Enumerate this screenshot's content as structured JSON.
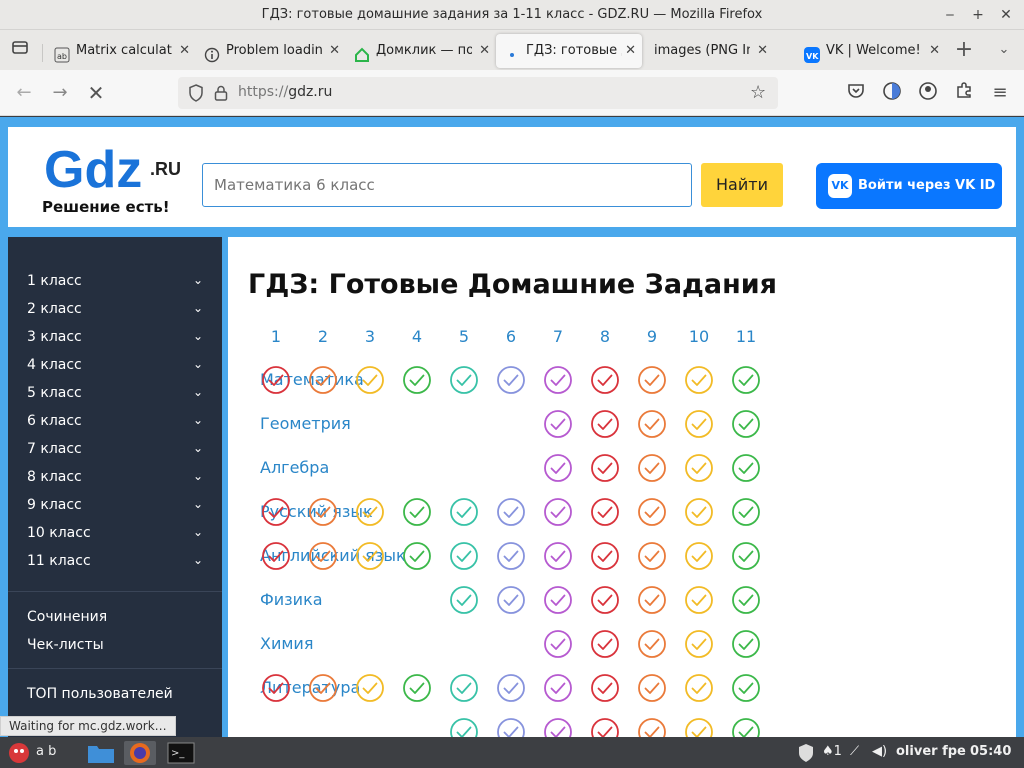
{
  "window": {
    "title": "ГДЗ: готовые домашние задания за 1-11 класс - GDZ.RU — Mozilla Firefox"
  },
  "tabs": [
    {
      "label": "Matrix calculator",
      "active": false
    },
    {
      "label": "Problem loading page",
      "active": false
    },
    {
      "label": "Домклик — по",
      "active": false
    },
    {
      "label": "ГДЗ: готовые д",
      "active": true
    },
    {
      "label": "images (PNG Image",
      "active": false
    },
    {
      "label": "VK | Welcome!",
      "active": false
    }
  ],
  "nav": {
    "url_scheme": "https://",
    "url_host": "gdz.ru"
  },
  "header": {
    "logo_main": "Gdz",
    "logo_tld": ".RU",
    "slogan": "Решение есть!",
    "search_placeholder": "Математика 6 класс",
    "search_button": "Найти",
    "vk_button": "Войти через  VK ID",
    "vk_icon": "VK"
  },
  "sidebar": {
    "grades": [
      "1 класс",
      "2 класс",
      "3 класс",
      "4 класс",
      "5 класс",
      "6 класс",
      "7 класс",
      "8 класс",
      "9 класс",
      "10 класс",
      "11 класс"
    ],
    "links": [
      "Сочинения",
      "Чек-листы"
    ],
    "top_users": "ТОП пользователей"
  },
  "main": {
    "title": "ГДЗ: Готовые Домашние Задания",
    "columns": [
      "1",
      "2",
      "3",
      "4",
      "5",
      "6",
      "7",
      "8",
      "9",
      "10",
      "11"
    ],
    "grade_colors": [
      "#d9333c",
      "#ea7a3a",
      "#f2bb26",
      "#3cb84a",
      "#38c2a7",
      "#8793dd",
      "#b65ad0",
      "#d9333c",
      "#ea7a3a",
      "#f2bb26",
      "#3cb84a"
    ],
    "subjects": [
      {
        "name": "Математика",
        "grades": [
          1,
          2,
          3,
          4,
          5,
          6,
          7,
          8,
          9,
          10,
          11
        ]
      },
      {
        "name": "Геометрия",
        "grades": [
          7,
          8,
          9,
          10,
          11
        ]
      },
      {
        "name": "Алгебра",
        "grades": [
          7,
          8,
          9,
          10,
          11
        ]
      },
      {
        "name": "Русский язык",
        "grades": [
          1,
          2,
          3,
          4,
          5,
          6,
          7,
          8,
          9,
          10,
          11
        ]
      },
      {
        "name": "Английский язык",
        "grades": [
          1,
          2,
          3,
          4,
          5,
          6,
          7,
          8,
          9,
          10,
          11
        ]
      },
      {
        "name": "Физика",
        "grades": [
          5,
          6,
          7,
          8,
          9,
          10,
          11
        ]
      },
      {
        "name": "Химия",
        "grades": [
          7,
          8,
          9,
          10,
          11
        ]
      },
      {
        "name": "Литература",
        "grades": [
          1,
          2,
          3,
          4,
          5,
          6,
          7,
          8,
          9,
          10,
          11
        ]
      },
      {
        "name": "",
        "grades": [
          5,
          6,
          7,
          8,
          9,
          10,
          11
        ]
      }
    ]
  },
  "status_text": "Waiting for mc.gdz.work…",
  "taskbar": {
    "label_ab": "a b",
    "user": "oliver fpe",
    "time": "05:40",
    "notif_count": "1"
  }
}
